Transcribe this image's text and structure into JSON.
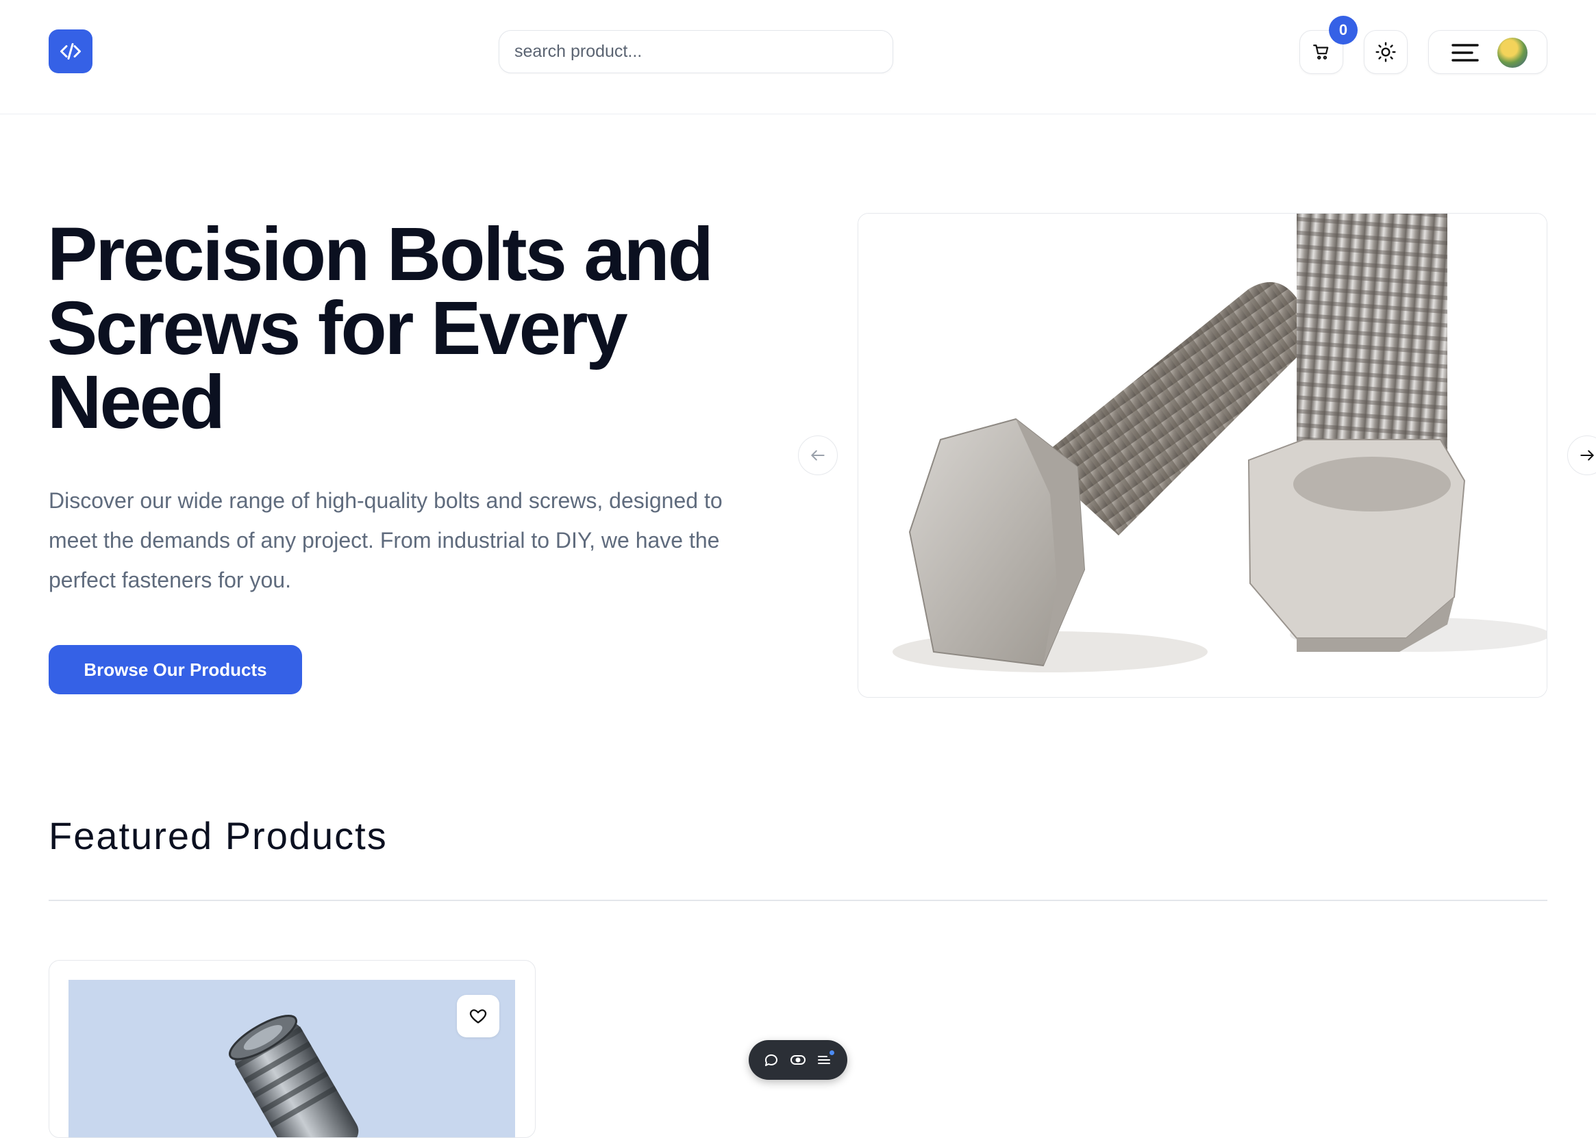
{
  "header": {
    "logo_icon": "code-icon",
    "search": {
      "placeholder": "search product...",
      "value": ""
    },
    "cart": {
      "icon": "cart-icon",
      "count": "0"
    },
    "theme_toggle_icon": "sun-icon",
    "menu_icon": "hamburger-icon",
    "avatar_icon": "avatar"
  },
  "hero": {
    "title": "Precision Bolts and Screws for Every Need",
    "description": "Discover our wide range of high-quality bolts and screws, designed to meet the demands of any project. From industrial to DIY, we have the perfect fasteners for you.",
    "cta_label": "Browse Our Products",
    "carousel": {
      "prev_icon": "arrow-left-icon",
      "next_icon": "arrow-right-icon"
    }
  },
  "featured": {
    "title": "Featured Products",
    "products": [
      {
        "favorite_icon": "heart-icon"
      }
    ]
  },
  "floating_toolbar": {
    "items": [
      "comment-icon",
      "eye-icon",
      "list-icon"
    ]
  },
  "colors": {
    "accent": "#3561e6",
    "heading": "#0b1020",
    "muted_text": "#5f6b7d",
    "toolbar_bg": "#2b2f36"
  }
}
